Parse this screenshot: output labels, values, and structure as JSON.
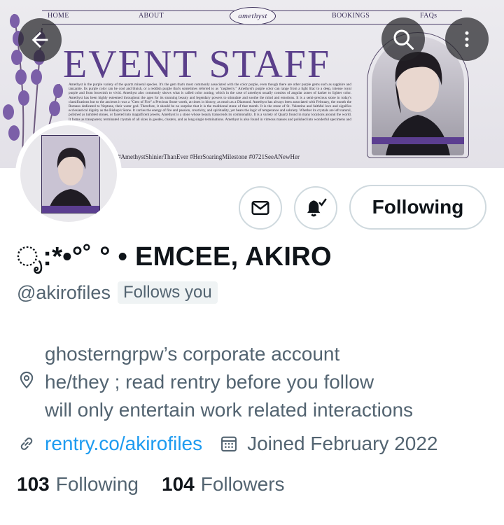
{
  "banner": {
    "nav": {
      "home": "HOME",
      "about": "ABOUT",
      "brand": "amethyst",
      "bookings": "BOOKINGS",
      "faqs": "FAQs"
    },
    "title": "EVENT STAFF",
    "paragraph": "Amethyst is the purple variety of the quartz mineral species. It's the gem that's most commonly associated with the color purple, even though there are other purple gems such as sapphire and tanzanite. Its purple color can be cool and bluish, or a reddish purple that's sometimes referred to as \"raspberry.\" Amethyst's purple color can range from a light lilac to a deep, intense royal purple and from brownish to vivid. Amethyst also commonly shows what is called color zoning, which in the case of amethyst usually consists of angular zones of darker to lighter color. Amethyst has been highly esteemed throughout the ages for its stunning beauty and legendary powers to stimulate and soothe the mind and emotions. It is a semi-precious stone in today's classifications but to the ancients it was a \"Gem of Fire\" a Precious Stone worth, at times in history, as much as a Diamond. Amethyst has always been associated with February, the month the Romans dedicated to Neptune, their water god. Therefore, it should be no surprise that it is the traditional stone of that month. It is the stone of St. Valentine and faithful love and signifies ecclesiastical dignity as the Bishop's Stone. It carries the energy of fire and passion, creativity, and spirituality, yet bears the logic of temperance and sobriety. Whether its crystals are left natural, polished as tumbled stones, or faceted into magnificent jewels, Amethyst is a stone whose beauty transcends its commonality. It is a variety of Quartz found in many locations around the world. It forms as transparent, terminated crystals of all sizes in geodes, clusters, and as long single terminations. Amethyst is also found in vitreous masses and polished into wonderful specimens and personal.",
    "hashtags": "#AmethystShinierThanEver #HerSoaringMilestone #0721SeeANewHer"
  },
  "profile": {
    "display_name": "ೃ:*•°˚ ° • EMCEE, AKIRO",
    "handle": "@akirofiles",
    "follows_you": "Follows you",
    "follow_button": "Following",
    "bio_lines": [
      "ghosterngrpw’s corporate account",
      "he/they ; read rentry before you follow",
      "will only entertain work related interactions"
    ],
    "link": "rentry.co/akirofiles",
    "joined": "Joined February 2022",
    "following_count": "103",
    "following_label": "Following",
    "followers_count": "104",
    "followers_label": "Followers"
  },
  "icons": {
    "back": "arrow-left-icon",
    "search": "search-icon",
    "more": "more-vertical-icon",
    "message": "envelope-icon",
    "notifications": "bell-icon",
    "location": "location-pin-icon",
    "link": "link-icon",
    "calendar": "calendar-icon"
  },
  "colors": {
    "accent": "#1d9bf0",
    "muted": "#536471",
    "text": "#0f1419",
    "border": "#cfd9de",
    "amethyst": "#5a3f8a"
  }
}
